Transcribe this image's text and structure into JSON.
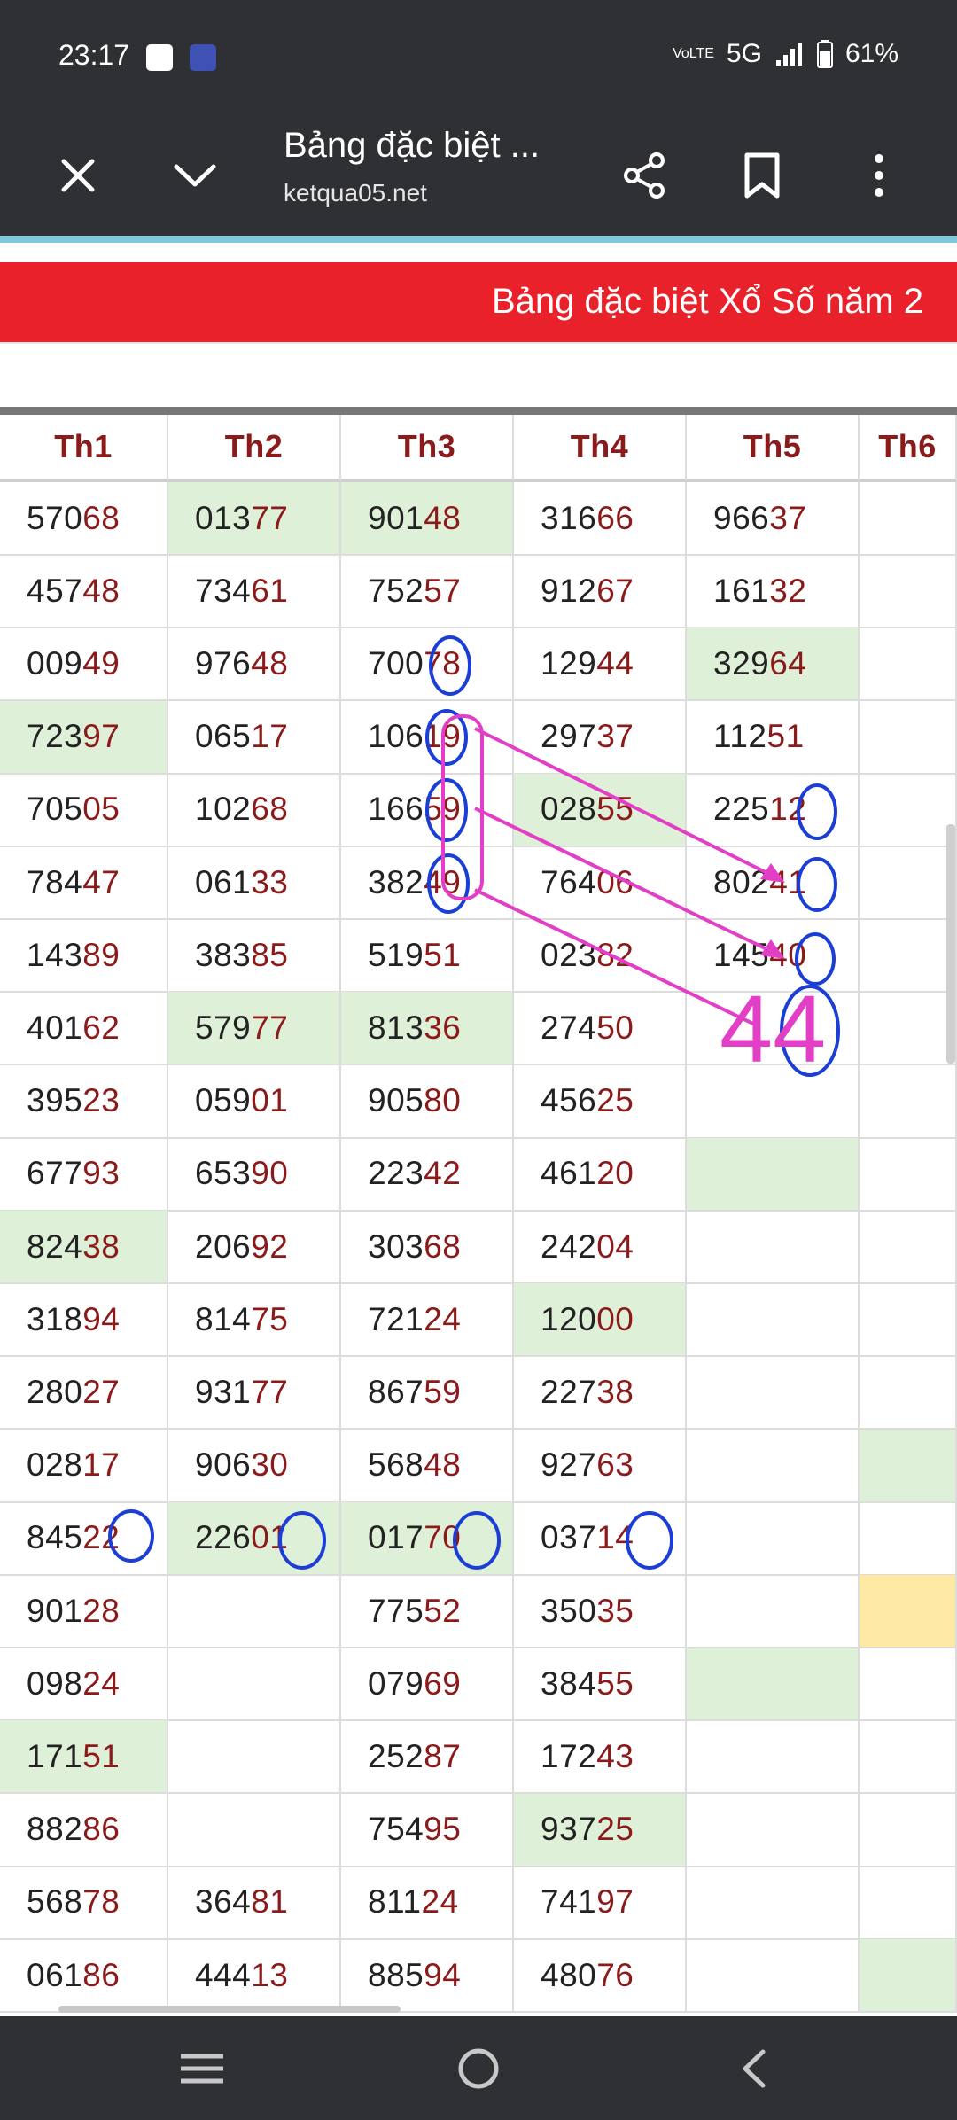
{
  "status": {
    "time": "23:17",
    "network": "5G",
    "lte": "VoLTE",
    "battery": "61%"
  },
  "browser": {
    "title": "Bảng đặc biệt ...",
    "url": "ketqua05.net"
  },
  "banner": {
    "text": "Bảng đặc biệt Xổ Số năm 2"
  },
  "table": {
    "headers": [
      "Th1",
      "Th2",
      "Th3",
      "Th4",
      "Th5",
      "Th6"
    ],
    "rows": [
      [
        "57068",
        "01377",
        "90148",
        "31666",
        "96637",
        ""
      ],
      [
        "45748",
        "73461",
        "75257",
        "91267",
        "16132",
        ""
      ],
      [
        "00949",
        "97648",
        "70078",
        "12944",
        "32964",
        ""
      ],
      [
        "72397",
        "06517",
        "10619",
        "29737",
        "11251",
        ""
      ],
      [
        "70505",
        "10268",
        "16659",
        "02855",
        "22512",
        ""
      ],
      [
        "78447",
        "06133",
        "38249",
        "76406",
        "80241",
        ""
      ],
      [
        "14389",
        "38385",
        "51951",
        "02382",
        "14540",
        ""
      ],
      [
        "40162",
        "57977",
        "81336",
        "27450",
        "",
        ""
      ],
      [
        "39523",
        "05901",
        "90580",
        "45625",
        "",
        ""
      ],
      [
        "67793",
        "65390",
        "22342",
        "46120",
        "",
        ""
      ],
      [
        "82438",
        "20692",
        "30368",
        "24204",
        "",
        ""
      ],
      [
        "31894",
        "81475",
        "72124",
        "12000",
        "",
        ""
      ],
      [
        "28027",
        "93177",
        "86759",
        "22738",
        "",
        ""
      ],
      [
        "02817",
        "90630",
        "56848",
        "92763",
        "",
        ""
      ],
      [
        "84522",
        "22601",
        "01770",
        "03714",
        "",
        ""
      ],
      [
        "90128",
        "",
        "77552",
        "35035",
        "",
        ""
      ],
      [
        "09824",
        "",
        "07969",
        "38455",
        "",
        ""
      ],
      [
        "17151",
        "",
        "25287",
        "17243",
        "",
        ""
      ],
      [
        "88286",
        "",
        "75495",
        "93725",
        "",
        ""
      ],
      [
        "56878",
        "36481",
        "81124",
        "74197",
        "",
        ""
      ],
      [
        "06186",
        "44413",
        "88594",
        "48076",
        "",
        ""
      ]
    ]
  },
  "annotation": {
    "big_number": "44"
  },
  "colors": {
    "dark_bar": "#2f3033",
    "banner_red": "#e8212a",
    "header_text": "#8b1a1a",
    "highlight_green": "#dff0d8",
    "highlight_yellow": "#fde8a4",
    "circle_blue": "#1a3ed6",
    "arrow_magenta": "#e23ec6"
  },
  "icons": [
    "close-icon",
    "chevron-down-icon",
    "share-icon",
    "bookmark-icon",
    "more-vert-icon",
    "recents-icon",
    "home-icon",
    "back-icon"
  ]
}
